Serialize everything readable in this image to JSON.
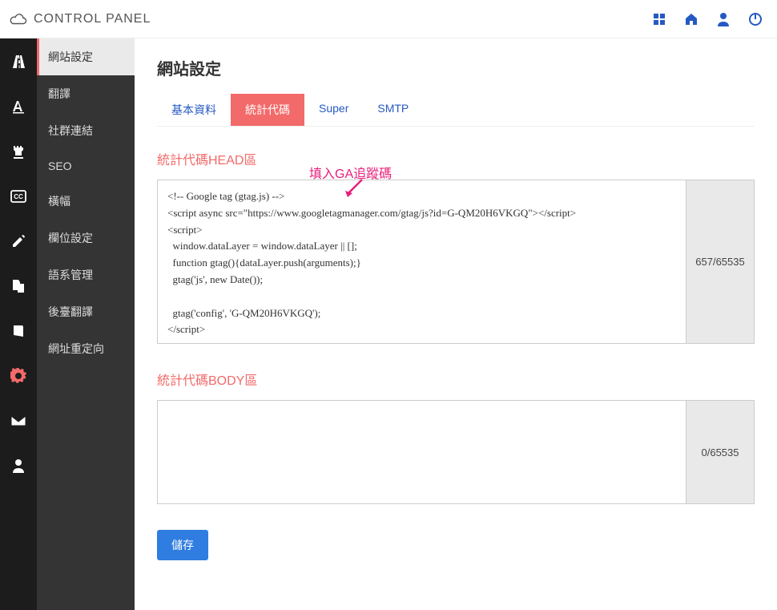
{
  "header": {
    "title": "CONTROL PANEL"
  },
  "submenu": {
    "items": [
      {
        "label": "網站設定",
        "active": true
      },
      {
        "label": "翻譯"
      },
      {
        "label": "社群連結"
      },
      {
        "label": "SEO"
      },
      {
        "label": "橫幅"
      },
      {
        "label": "欄位設定"
      },
      {
        "label": "語系管理"
      },
      {
        "label": "後臺翻譯"
      },
      {
        "label": "網址重定向"
      }
    ]
  },
  "page": {
    "title": "網站設定",
    "tabs": [
      {
        "label": "基本資料"
      },
      {
        "label": "統計代碼",
        "active": true
      },
      {
        "label": "Super"
      },
      {
        "label": "SMTP"
      }
    ],
    "annotation": "填入GA追蹤碼",
    "head_section": {
      "label": "統計代碼HEAD區",
      "value": "<!-- Google tag (gtag.js) -->\n<script async src=\"https://www.googletagmanager.com/gtag/js?id=G-QM20H6VKGQ\"></script>\n<script>\n  window.dataLayer = window.dataLayer || [];\n  function gtag(){dataLayer.push(arguments);}\n  gtag('js', new Date());\n\n  gtag('config', 'G-QM20H6VKGQ');\n</script>",
      "counter": "657/65535"
    },
    "body_section": {
      "label": "統計代碼BODY區",
      "value": "",
      "counter": "0/65535"
    },
    "save_label": "儲存"
  }
}
